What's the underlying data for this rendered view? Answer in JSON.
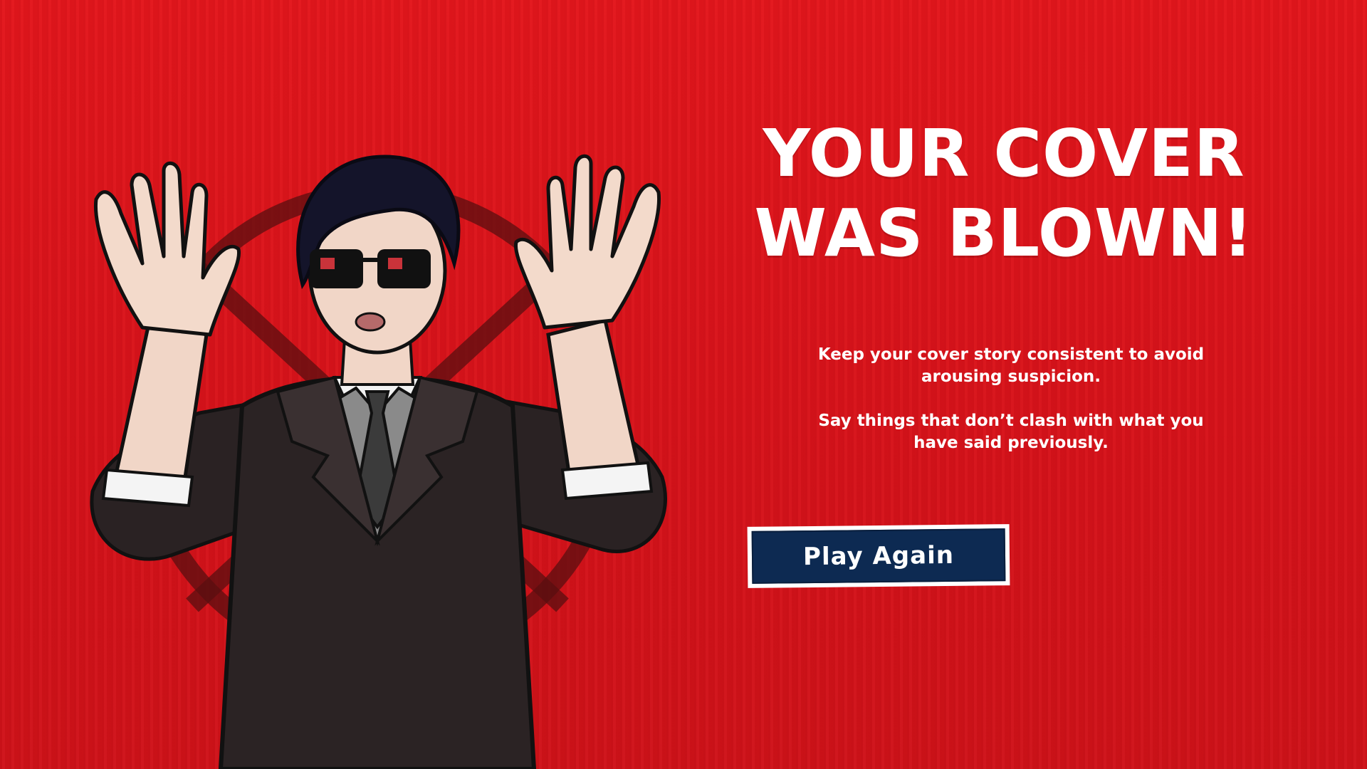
{
  "screen": {
    "title": "YOUR COVER WAS BLOWN!",
    "hint_line_1": "Keep your cover story consistent to avoid arousing suspicion.",
    "hint_line_2": "Say things that don’t clash with what you have said previously.",
    "play_again_label": "Play Again"
  },
  "colors": {
    "background": "#d9141a",
    "button": "#0d2a52",
    "text": "#ffffff"
  },
  "icons": {
    "background_symbol": "crossed-circle-icon",
    "character": "surrendering-spy-illustration"
  }
}
